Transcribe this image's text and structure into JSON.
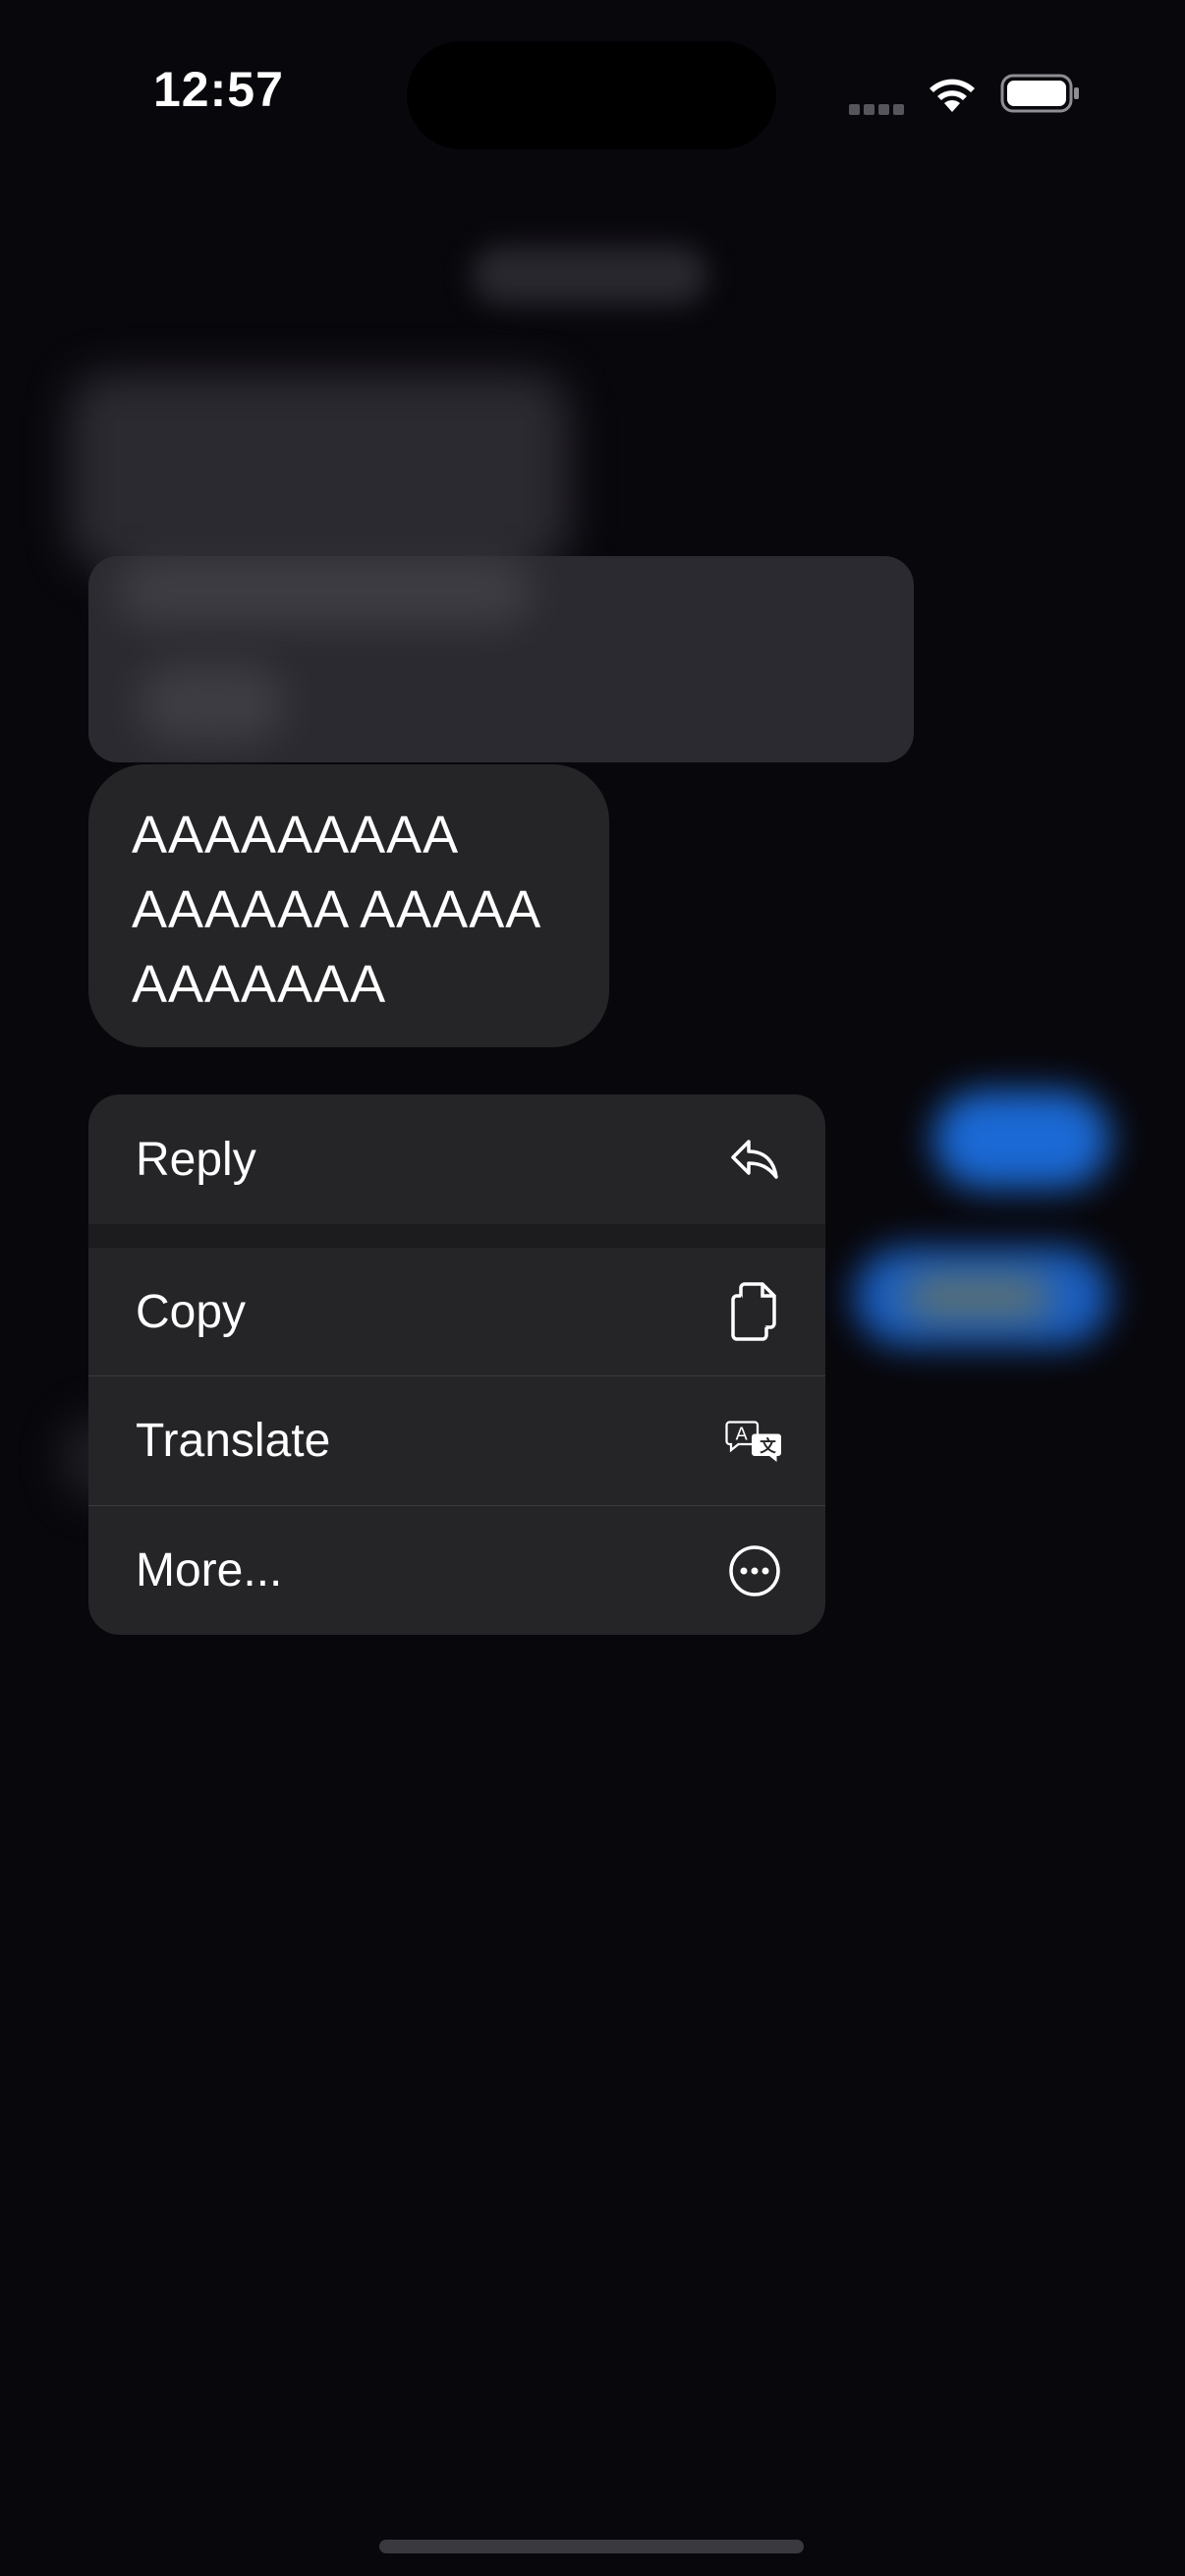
{
  "status_bar": {
    "time": "12:57"
  },
  "message": {
    "text_lines": [
      "AAAAAAAAA",
      "AAAAAA AAAAA",
      "AAAAAAA"
    ]
  },
  "context_menu": {
    "items": [
      {
        "label": "Reply",
        "icon": "reply-arrow-icon"
      },
      {
        "label": "Copy",
        "icon": "copy-documents-icon"
      },
      {
        "label": "Translate",
        "icon": "translate-icon"
      },
      {
        "label": "More...",
        "icon": "ellipsis-circle-icon"
      }
    ]
  },
  "colors": {
    "background": "#08070c",
    "bubble": "#252528",
    "menu": "#252528",
    "accent_blue": "#1c6fe0"
  }
}
